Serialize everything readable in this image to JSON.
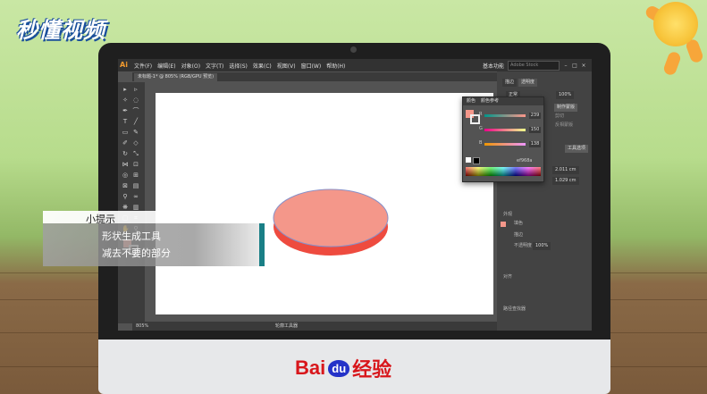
{
  "watermark": {
    "channel": "秒懂视频",
    "brand_prefix": "Bai",
    "brand_mark": "du",
    "brand_suffix": "经验"
  },
  "app": {
    "logo": "Ai",
    "menu": [
      "文件(F)",
      "编辑(E)",
      "对象(O)",
      "文字(T)",
      "选择(S)",
      "效果(C)",
      "视图(V)",
      "窗口(W)",
      "帮助(H)"
    ],
    "workspace": "基本功能",
    "search_placeholder": "Adobe Stock",
    "window_controls": [
      "–",
      "□",
      "×"
    ]
  },
  "document": {
    "tab_label": "未标题-1* @ 805% (RGB/GPU 预览)",
    "zoom": "805%",
    "status": "轮廓工具器"
  },
  "color_panel": {
    "tabs": [
      "颜色",
      "颜色参考"
    ],
    "channels": [
      {
        "label": "R",
        "value": "239"
      },
      {
        "label": "G",
        "value": "150"
      },
      {
        "label": "B",
        "value": "138"
      }
    ],
    "hex": "ef968a"
  },
  "right_dock": {
    "tabs": [
      "描边",
      "透明度"
    ],
    "blend_mode": "正常",
    "opacity": "100%",
    "make_mask": "制作蒙版",
    "clip": "剪切",
    "invert_mask": "反相蒙版",
    "stroke_width": "2.011 cm",
    "stroke_height": "1.029 cm",
    "appearance_label": "外观",
    "fill_label": "填色",
    "stroke_label": "描边",
    "opacity_label": "不透明度",
    "opacity_value": "100%",
    "align_label": "对齐",
    "pathfinder_label": "路径查找器",
    "tool_link": "工具选项"
  },
  "shape": {
    "fill_color": "#f4978a",
    "side_color": "#ee4b3f",
    "stroke_color": "#8890c8"
  },
  "tip": {
    "title": "小提示",
    "line1": "形状生成工具",
    "line2": "减去不要的部分"
  }
}
